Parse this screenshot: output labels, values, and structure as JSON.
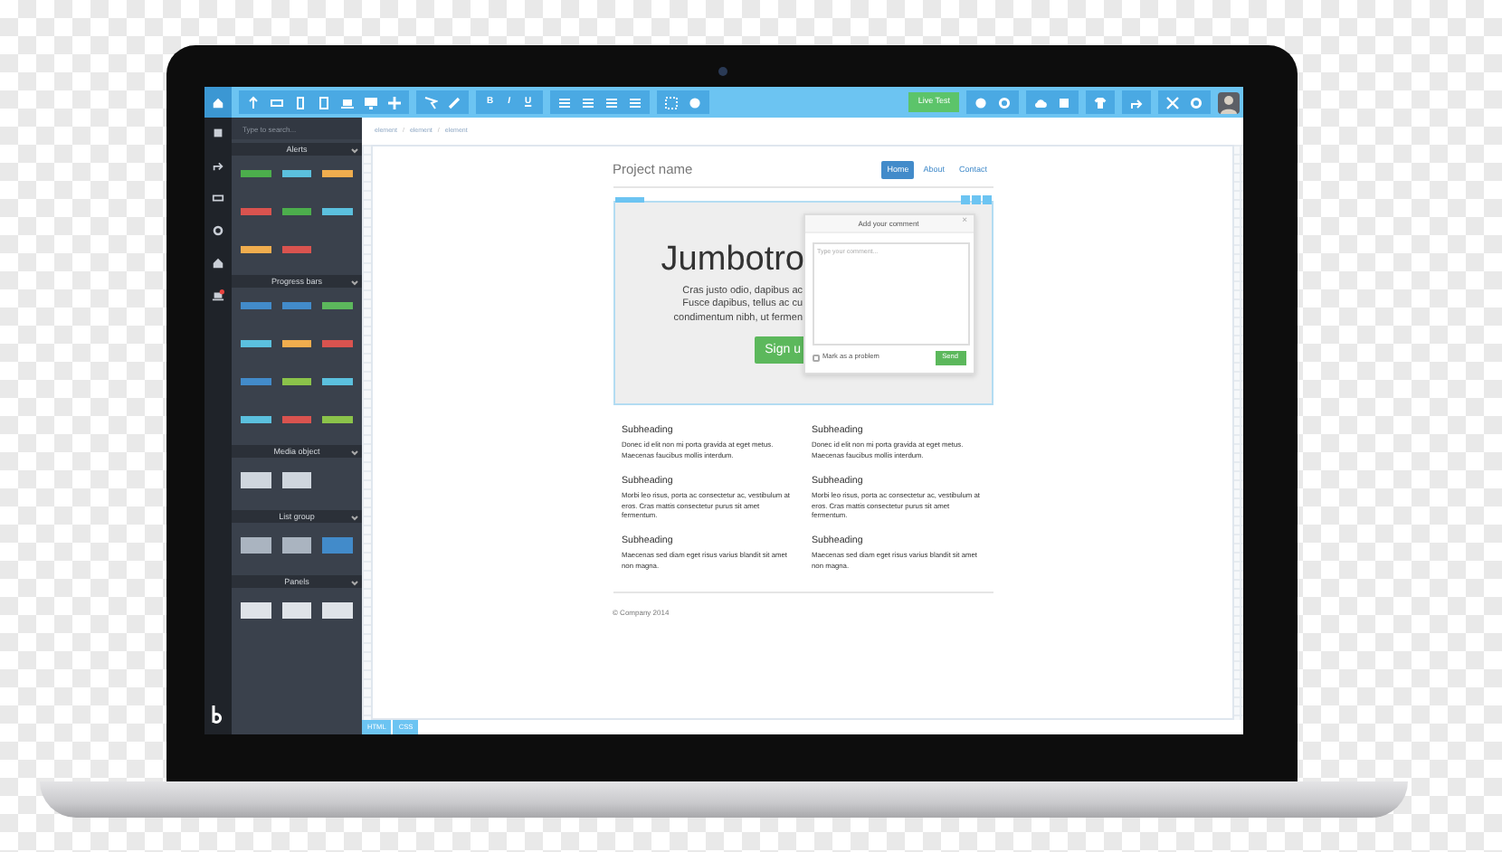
{
  "toolbar": {
    "format_buttons": [
      "B",
      "I",
      "U"
    ],
    "live_button": "Live Test"
  },
  "sidebar": {
    "search": {
      "placeholder": "Type to search..."
    },
    "sections": [
      {
        "title": "Alerts",
        "items": [
          {
            "color": "#4cae4c"
          },
          {
            "color": "#5bc0de"
          },
          {
            "color": "#f0ad4e"
          },
          {
            "color": "#d9534f"
          },
          {
            "color": "#4cae4c"
          },
          {
            "color": "#5bc0de"
          },
          {
            "color": "#f0ad4e"
          },
          {
            "color": "#d9534f"
          }
        ]
      },
      {
        "title": "Progress bars",
        "items": [
          {
            "color": "#428bca"
          },
          {
            "color": "#428bca"
          },
          {
            "color": "#5cb85c"
          },
          {
            "color": "#5bc0de"
          },
          {
            "color": "#f0ad4e"
          },
          {
            "color": "#d9534f"
          },
          {
            "color": "#428bca"
          },
          {
            "color": "#8bc34a"
          },
          {
            "color": "#5bc0de"
          },
          {
            "color": "#5bc0de"
          },
          {
            "color": "#d9534f"
          },
          {
            "color": "#8bc34a"
          }
        ]
      },
      {
        "title": "Media object",
        "items": [
          {
            "color": "#cfd6de"
          },
          {
            "color": "#cfd6de"
          }
        ]
      },
      {
        "title": "List group",
        "items": [
          {
            "color": "#aab4c0"
          },
          {
            "color": "#aab4c0"
          },
          {
            "color": "#428bca"
          }
        ]
      },
      {
        "title": "Panels",
        "items": [
          {
            "color": "#dfe3e8"
          },
          {
            "color": "#dfe3e8"
          },
          {
            "color": "#dfe3e8"
          }
        ]
      }
    ]
  },
  "breadcrumb": {
    "items": [
      "element",
      "element",
      "element"
    ],
    "separators": [
      "/",
      "/"
    ]
  },
  "site": {
    "brand": "Project name",
    "nav": [
      {
        "label": "Home",
        "selected": true
      },
      {
        "label": "About",
        "selected": false
      },
      {
        "label": "Contact",
        "selected": false
      }
    ],
    "jumbotron": {
      "heading": "Jumbotro",
      "lines": [
        "Cras justo odio, dapibus ac",
        "Fusce dapibus, tellus ac cu",
        "condimentum nibh, ut fermen"
      ],
      "button": "Sign u"
    },
    "comment": {
      "title": "Add your comment",
      "close": "×",
      "placeholder": "Type your comment...",
      "checkbox": {
        "label": "Mark as a problem",
        "checked": false
      },
      "send": "Send"
    },
    "features": [
      {
        "heading": "Subheading",
        "text": "Donec id elit non mi porta gravida at eget metus. Maecenas faucibus mollis interdum."
      },
      {
        "heading": "Subheading",
        "text": "Donec id elit non mi porta gravida at eget metus. Maecenas faucibus mollis interdum."
      },
      {
        "heading": "Subheading",
        "text": "Morbi leo risus, porta ac consectetur ac, vestibulum at eros. Cras mattis consectetur purus sit amet fermentum."
      },
      {
        "heading": "Subheading",
        "text": "Morbi leo risus, porta ac consectetur ac, vestibulum at eros. Cras mattis consectetur purus sit amet fermentum."
      },
      {
        "heading": "Subheading",
        "text": "Maecenas sed diam eget risus varius blandit sit amet non magna."
      },
      {
        "heading": "Subheading",
        "text": "Maecenas sed diam eget risus varius blandit sit amet non magna."
      }
    ],
    "footer": "© Company 2014"
  },
  "bottom_tabs": [
    {
      "label": "HTML",
      "selected": false
    },
    {
      "label": "CSS",
      "selected": false
    }
  ]
}
